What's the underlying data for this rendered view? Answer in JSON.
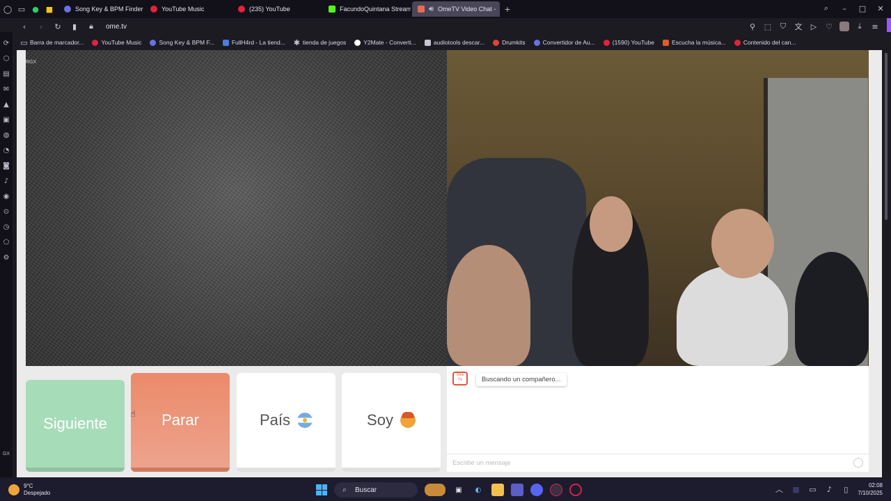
{
  "browser": {
    "tabs": [
      {
        "label": "Song Key & BPM Finder",
        "icon": "music-note-icon",
        "color": "#6a72e0"
      },
      {
        "label": "YouTube Music",
        "icon": "youtube-music-icon",
        "color": "#e0243a"
      },
      {
        "label": "(235) YouTube",
        "icon": "youtube-icon",
        "color": "#e0243a"
      },
      {
        "label": "FacundoQuintana Stream",
        "icon": "kick-icon",
        "color": "#53fc18"
      },
      {
        "label": "OmeTV Video Chat -",
        "icon": "ometv-icon",
        "color": "#e86a54",
        "active": true
      }
    ],
    "url": "ome.tv",
    "bookmarks": [
      {
        "label": "Barra de marcador...",
        "icon": "folder-icon",
        "color": "#c9c6d3"
      },
      {
        "label": "YouTube Music",
        "icon": "youtube-music-icon",
        "color": "#e0243a"
      },
      {
        "label": "Song Key & BPM F...",
        "icon": "music-note-icon",
        "color": "#6a72e0"
      },
      {
        "label": "FullH4rd - La tiend...",
        "icon": "fullh4rd-icon",
        "color": "#4a7de0"
      },
      {
        "label": "tienda de juegos",
        "icon": "gear-icon",
        "color": "#c9c6d3"
      },
      {
        "label": "Y2Mate - Converti...",
        "icon": "y2mate-icon",
        "color": "#ffffff"
      },
      {
        "label": "audiotools descar...",
        "icon": "audiotools-icon",
        "color": "#c9c6d3"
      },
      {
        "label": "Drumkits",
        "icon": "drumkits-icon",
        "color": "#e0433c"
      },
      {
        "label": "Convertidor de Au...",
        "icon": "converter-icon",
        "color": "#6a72e0"
      },
      {
        "label": "(1590) YouTube",
        "icon": "youtube-icon",
        "color": "#e0243a"
      },
      {
        "label": "Escucha la música...",
        "icon": "music-icon",
        "color": "#e05a2a"
      },
      {
        "label": "Contenido del can...",
        "icon": "youtube-icon",
        "color": "#e0243a"
      }
    ]
  },
  "page": {
    "video_left_watermark": "RGX",
    "buttons": {
      "next": "Siguiente",
      "stop": "Parar",
      "country": "País",
      "me": "Soy"
    },
    "chat": {
      "logo_text": "Ome TV",
      "status": "Buscando un compañero...",
      "input_placeholder": "Escribe un mensaje"
    }
  },
  "sidebar": {
    "gx_label": "GX"
  },
  "taskbar": {
    "weather_temp": "9°C",
    "weather_desc": "Despejado",
    "search_label": "Buscar",
    "time": "02:08",
    "date": "7/10/2025"
  }
}
